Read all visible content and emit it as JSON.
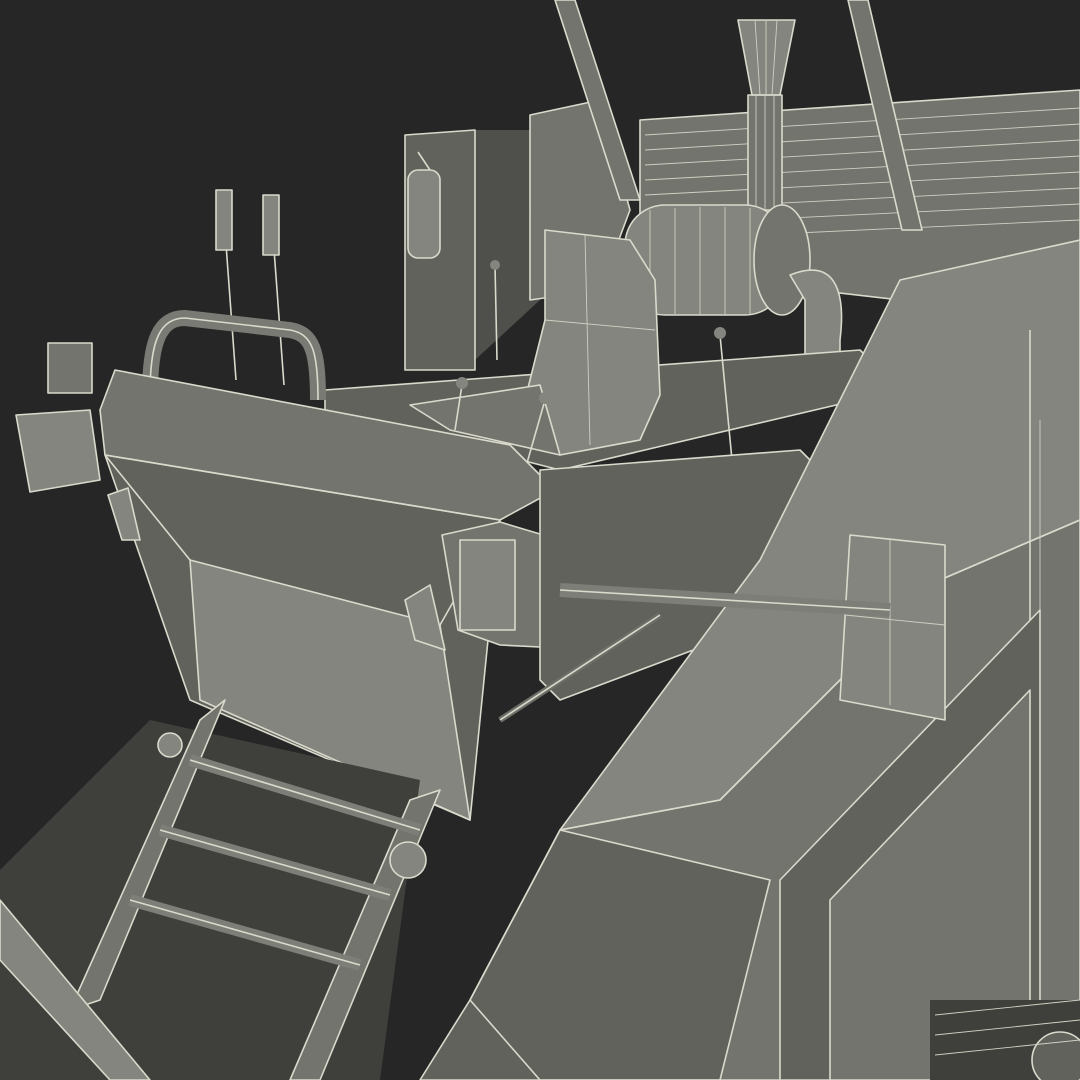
{
  "scene": {
    "background_color": "#262626",
    "model_color": "#6a6a64",
    "wire_color": "#d9d9cc"
  }
}
